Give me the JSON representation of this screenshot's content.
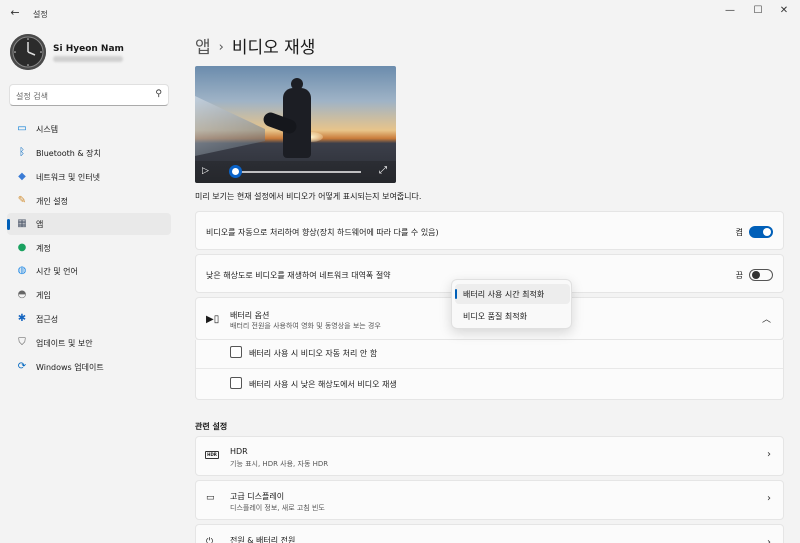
{
  "window": {
    "back_icon": "back-arrow-icon",
    "title": "설정",
    "controls": [
      "minimize-icon",
      "maximize-icon",
      "close-icon"
    ]
  },
  "user": {
    "name": "Si Hyeon Nam"
  },
  "search": {
    "placeholder": "설정 검색"
  },
  "sidebar": {
    "items": [
      {
        "label": "시스템",
        "icon": "monitor-icon",
        "color": "#0078d4"
      },
      {
        "label": "Bluetooth & 장치",
        "icon": "bluetooth-icon",
        "color": "#0067c0"
      },
      {
        "label": "네트워크 및 인터넷",
        "icon": "wifi-icon",
        "color": "#3a7bd5"
      },
      {
        "label": "개인 설정",
        "icon": "pen-icon",
        "color": "#d08b2c"
      },
      {
        "label": "앱",
        "icon": "apps-icon",
        "color": "#4a5568",
        "active": true
      },
      {
        "label": "계정",
        "icon": "person-icon",
        "color": "#1aa260"
      },
      {
        "label": "시간 및 언어",
        "icon": "globe-clock-icon",
        "color": "#1e88e5"
      },
      {
        "label": "게임",
        "icon": "gamepad-icon",
        "color": "#666666"
      },
      {
        "label": "접근성",
        "icon": "accessibility-icon",
        "color": "#1565c0"
      },
      {
        "label": "업데이트 및 보안",
        "icon": "shield-icon",
        "color": "#555555"
      },
      {
        "label": "Windows 업데이트",
        "icon": "update-icon",
        "color": "#0067c0"
      }
    ]
  },
  "breadcrumb": {
    "parent": "앱",
    "separator": "›",
    "current": "비디오 재생"
  },
  "preview": {
    "caption": "미리 보기는 현재 설정에서 비디오가 어떻게 표시되는지 보여줍니다.",
    "progress": 0.0
  },
  "settings": {
    "auto_process": {
      "label": "비디오를 자동으로 처리하여 향상(장치 하드웨어에 따라 다를 수 있음)",
      "state_label": "켬",
      "on": true
    },
    "low_res": {
      "label": "낮은 해상도로 비디오를 재생하여 네트워크 대역폭 절약",
      "state_label": "끔",
      "on": false
    },
    "battery": {
      "icon": "battery-video-icon",
      "title": "배터리 옵션",
      "subtitle": "배터리 전원을 사용하여 영화 및 동영상을 보는 경우",
      "options": [
        "배터리 사용 시간 최적화",
        "비디오 품질 최적화"
      ],
      "selected": "배터리 사용 시간 최적화",
      "checkboxes": [
        {
          "label": "배터리 사용 시 비디오 자동 처리 안 함",
          "checked": false
        },
        {
          "label": "배터리 사용 시 낮은 해상도에서 비디오 재생",
          "checked": false
        }
      ]
    }
  },
  "related": {
    "title": "관련 설정",
    "items": [
      {
        "title": "HDR",
        "subtitle": "기능 표시, HDR 사용, 자동 HDR",
        "icon": "hdr-icon",
        "badge": "HDR"
      },
      {
        "title": "고급 디스플레이",
        "subtitle": "디스플레이 정보, 새로 고침 빈도",
        "icon": "laptop-icon"
      },
      {
        "title": "전원 & 배터리 전원",
        "icon": "power-icon"
      }
    ]
  }
}
